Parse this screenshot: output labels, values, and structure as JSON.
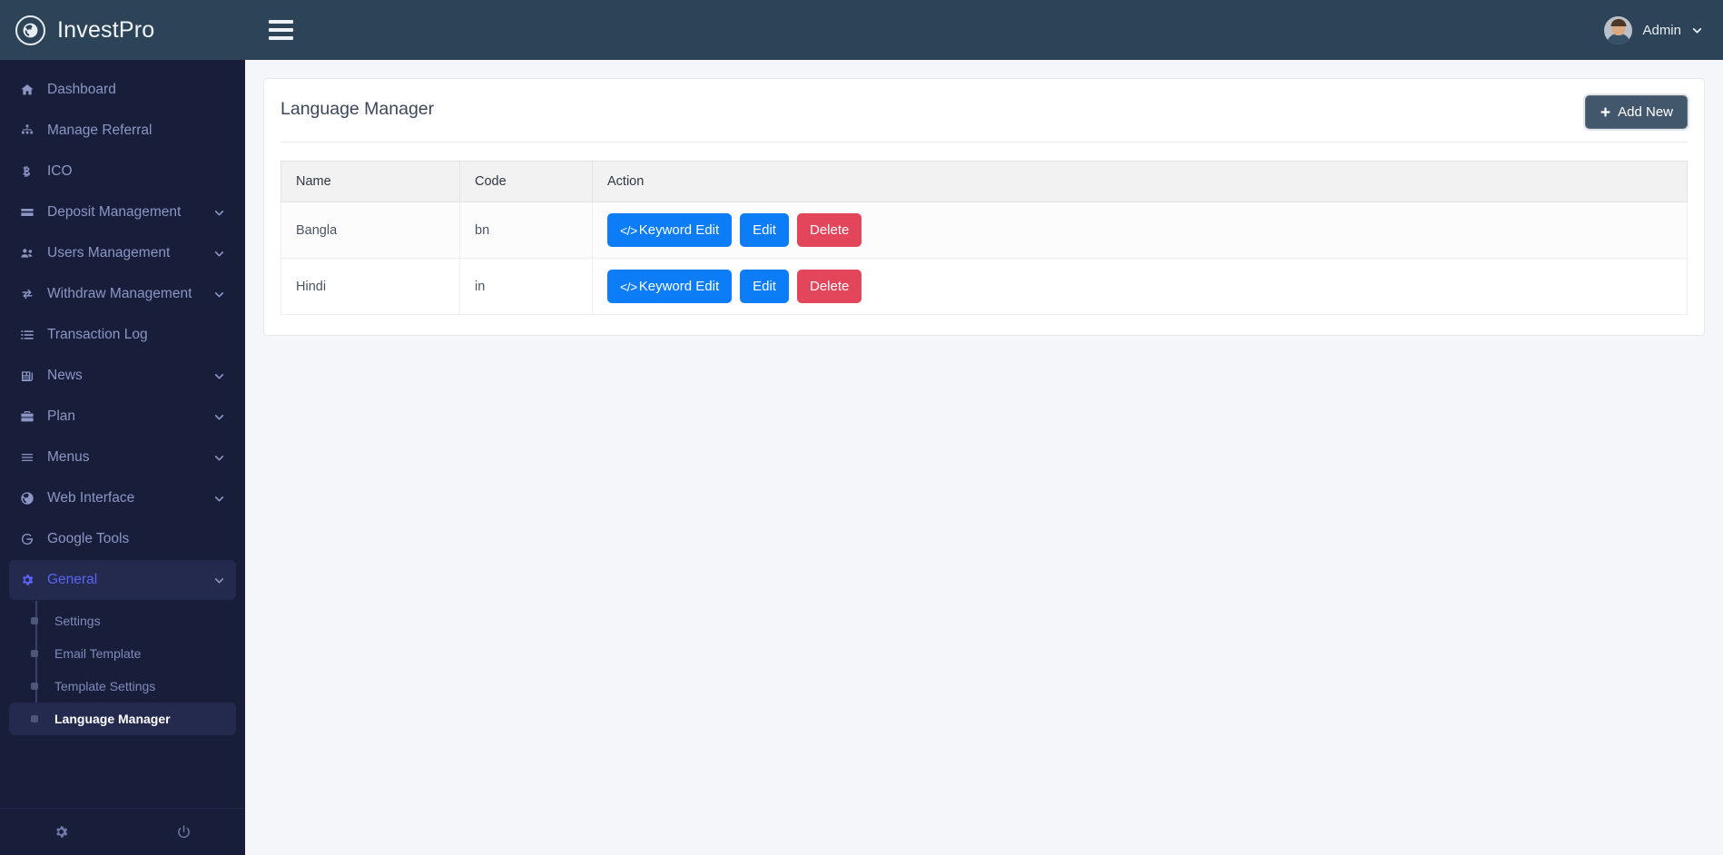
{
  "brand": {
    "name": "InvestPro",
    "logo_icon": "globe-icon"
  },
  "topbar": {
    "menu_toggle_icon": "hamburger-icon",
    "user_name": "Admin",
    "user_caret_icon": "chevron-down-icon",
    "avatar_icon": "user-avatar"
  },
  "sidebar": {
    "items": [
      {
        "label": "Dashboard",
        "icon": "home-icon",
        "caret": false,
        "active": false
      },
      {
        "label": "Manage Referral",
        "icon": "sitemap-icon",
        "caret": false,
        "active": false
      },
      {
        "label": "ICO",
        "icon": "bitcoin-icon",
        "caret": false,
        "active": false
      },
      {
        "label": "Deposit Management",
        "icon": "credit-card-icon",
        "caret": true,
        "active": false
      },
      {
        "label": "Users Management",
        "icon": "users-icon",
        "caret": true,
        "active": false
      },
      {
        "label": "Withdraw Management",
        "icon": "exchange-icon",
        "caret": true,
        "active": false
      },
      {
        "label": "Transaction Log",
        "icon": "list-icon",
        "caret": false,
        "active": false
      },
      {
        "label": "News",
        "icon": "newspaper-icon",
        "caret": true,
        "active": false
      },
      {
        "label": "Plan",
        "icon": "briefcase-icon",
        "caret": true,
        "active": false
      },
      {
        "label": "Menus",
        "icon": "bars-icon",
        "caret": true,
        "active": false
      },
      {
        "label": "Web Interface",
        "icon": "globe-icon",
        "caret": true,
        "active": false
      },
      {
        "label": "Google Tools",
        "icon": "google-icon",
        "caret": false,
        "active": false
      },
      {
        "label": "General",
        "icon": "gear-icon",
        "caret": true,
        "active": true
      }
    ],
    "submenu": [
      {
        "label": "Settings",
        "active": false
      },
      {
        "label": "Email Template",
        "active": false
      },
      {
        "label": "Template Settings",
        "active": false
      },
      {
        "label": "Language Manager",
        "active": true
      }
    ],
    "footer": [
      {
        "icon": "gear-icon",
        "name": "settings"
      },
      {
        "icon": "power-icon",
        "name": "logout"
      }
    ]
  },
  "page": {
    "title": "Language Manager",
    "add_new_label": "Add New",
    "add_new_icon": "plus-icon"
  },
  "table": {
    "columns": [
      "Name",
      "Code",
      "Action"
    ],
    "rows": [
      {
        "name": "Bangla",
        "code": "bn",
        "actions": [
          {
            "label": "Keyword Edit",
            "style": "primary",
            "icon": "code-icon"
          },
          {
            "label": "Edit",
            "style": "primary",
            "icon": ""
          },
          {
            "label": "Delete",
            "style": "danger",
            "icon": ""
          }
        ]
      },
      {
        "name": "Hindi",
        "code": "in",
        "actions": [
          {
            "label": "Keyword Edit",
            "style": "primary",
            "icon": "code-icon"
          },
          {
            "label": "Edit",
            "style": "primary",
            "icon": ""
          },
          {
            "label": "Delete",
            "style": "danger",
            "icon": ""
          }
        ]
      }
    ]
  },
  "colors": {
    "sidebar_bg": "#181d3a",
    "header_bg": "#2d4358",
    "accent_active": "#5a63f3",
    "primary_btn": "#0d7cf7",
    "danger_btn": "#e3465b",
    "addnew_btn": "#42576b",
    "content_bg": "#f4f6fa"
  }
}
